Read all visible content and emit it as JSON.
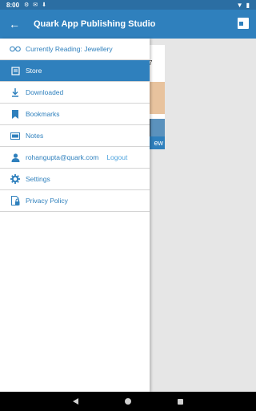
{
  "status_bar": {
    "time": "8:00",
    "icons_left": [
      "settings-icon",
      "alert-icon",
      "download-icon"
    ],
    "icons_right": [
      "wifi-icon",
      "battery-icon"
    ]
  },
  "app_bar": {
    "title": "Quark App Publishing Studio",
    "back_icon": "arrow-back-icon",
    "action_icon": "window-icon"
  },
  "background_content": {
    "button_fragment": "ew"
  },
  "drawer": {
    "items": [
      {
        "label": "Currently Reading: Jewellery",
        "icon": "glasses-icon",
        "active": false
      },
      {
        "label": "Store",
        "icon": "store-icon",
        "active": true
      },
      {
        "label": "Downloaded",
        "icon": "download-icon",
        "active": false
      },
      {
        "label": "Bookmarks",
        "icon": "bookmark-icon",
        "active": false
      },
      {
        "label": "Notes",
        "icon": "notes-icon",
        "active": false
      },
      {
        "label": "rohangupta@quark.com",
        "icon": "person-icon",
        "active": false,
        "link": "Logout"
      },
      {
        "label": "Settings",
        "icon": "gear-icon",
        "active": false
      },
      {
        "label": "Privacy Policy",
        "icon": "privacy-icon",
        "active": false
      }
    ]
  },
  "colors": {
    "primary": "#2f80bd",
    "status_bar": "#2b6ea3",
    "divider": "#d4d4d4"
  }
}
